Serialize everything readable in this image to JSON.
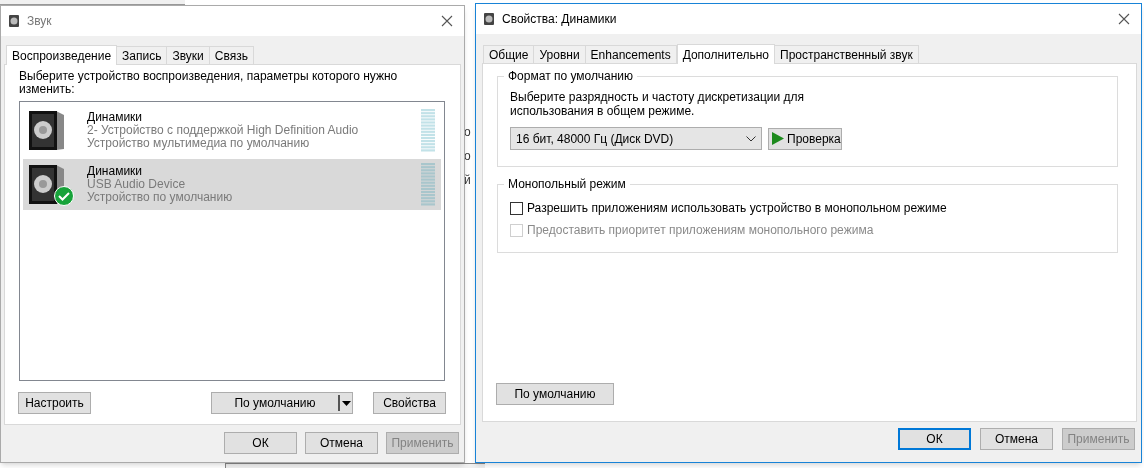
{
  "background_fragments": [
    "о",
    "о",
    "й"
  ],
  "sound_window": {
    "title": "Звук",
    "tabs": [
      {
        "label": "Воспроизведение",
        "selected": true
      },
      {
        "label": "Запись",
        "selected": false
      },
      {
        "label": "Звуки",
        "selected": false
      },
      {
        "label": "Связь",
        "selected": false
      }
    ],
    "instruction": "Выберите устройство воспроизведения, параметры которого нужно изменить:",
    "devices": [
      {
        "name": "Динамики",
        "description": "2- Устройство с поддержкой High Definition Audio",
        "status": "Устройство мультимедиа по умолчанию",
        "selected": false,
        "default": false
      },
      {
        "name": "Динамики",
        "description": "USB Audio Device",
        "status": "Устройство по умолчанию",
        "selected": true,
        "default": true
      }
    ],
    "buttons": {
      "configure": "Настроить",
      "set_default": "По умолчанию",
      "properties": "Свойства"
    },
    "footer": [
      {
        "label": "ОК",
        "disabled": false,
        "focused": false
      },
      {
        "label": "Отмена",
        "disabled": false,
        "focused": false
      },
      {
        "label": "Применить",
        "disabled": true,
        "focused": false
      }
    ]
  },
  "properties_window": {
    "title": "Свойства: Динамики",
    "tabs": [
      {
        "label": "Общие",
        "selected": false
      },
      {
        "label": "Уровни",
        "selected": false
      },
      {
        "label": "Enhancements",
        "selected": false
      },
      {
        "label": "Дополнительно",
        "selected": true
      },
      {
        "label": "Пространственный звук",
        "selected": false
      }
    ],
    "format_group": {
      "legend": "Формат по умолчанию",
      "description": "Выберите разрядность и частоту дискретизации для использования в общем режиме.",
      "format": "16 бит, 48000 Гц (Диск DVD)",
      "test_button": "Проверка"
    },
    "exclusive_group": {
      "legend": "Монопольный режим",
      "options": [
        {
          "label": "Разрешить приложениям использовать устройство в монопольном режиме",
          "checked": false,
          "disabled": false
        },
        {
          "label": "Предоставить приоритет приложениям монопольного режима",
          "checked": false,
          "disabled": true
        }
      ]
    },
    "restore_button": "По умолчанию",
    "footer": [
      {
        "label": "ОК",
        "disabled": false,
        "focused": true
      },
      {
        "label": "Отмена",
        "disabled": false,
        "focused": false
      },
      {
        "label": "Применить",
        "disabled": true,
        "focused": false
      }
    ]
  }
}
